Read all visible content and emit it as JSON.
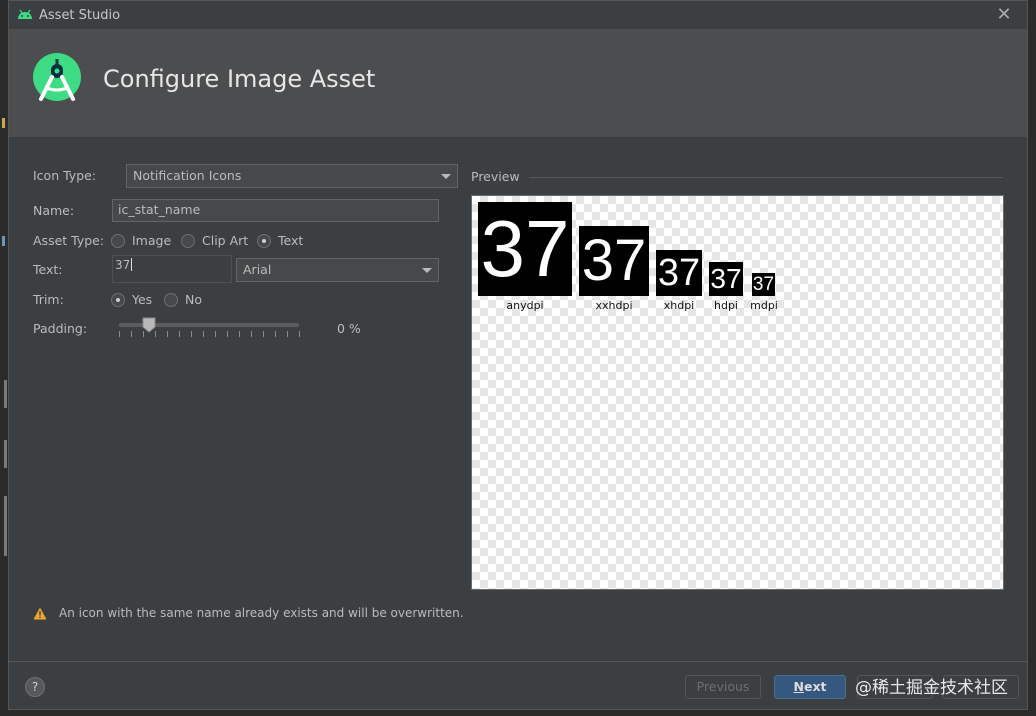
{
  "window": {
    "title": "Asset Studio"
  },
  "header": {
    "title": "Configure Image Asset"
  },
  "form": {
    "icon_type_label": "Icon Type:",
    "icon_type_value": "Notification Icons",
    "name_label": "Name:",
    "name_value": "ic_stat_name",
    "asset_type_label": "Asset Type:",
    "asset_type_options": [
      "Image",
      "Clip Art",
      "Text"
    ],
    "asset_type_selected": "Text",
    "text_label": "Text:",
    "text_value": "37",
    "font_value": "Arial",
    "trim_label": "Trim:",
    "trim_options": [
      "Yes",
      "No"
    ],
    "trim_selected": "Yes",
    "padding_label": "Padding:",
    "padding_value": "0 %",
    "padding_percent": 0
  },
  "preview": {
    "label": "Preview",
    "icon_text": "37",
    "densities": [
      "anydpi",
      "xxhdpi",
      "xhdpi",
      "hdpi",
      "mdpi"
    ]
  },
  "warning": {
    "text": "An icon with the same name already exists and will be overwritten."
  },
  "footer": {
    "help": "?",
    "previous": "Previous",
    "next_mnemonic": "N",
    "next_rest": "ext"
  },
  "watermark": "@稀土掘金技术社区",
  "colors": {
    "accent_button": "#365880",
    "android_green": "#3ddc84",
    "warning": "#f0a732"
  }
}
